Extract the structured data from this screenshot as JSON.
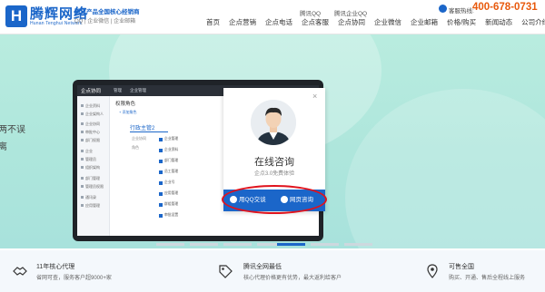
{
  "header": {
    "logo_mark": "H",
    "logo_name": "腾辉网络",
    "logo_en": "Hunan Tenghui Network",
    "slogan_line1": "腾讯产品全国核心经销商",
    "slogan_line2": "QQ | 企业微信 | 企业邮箱",
    "brand_tags": [
      "腾讯QQ",
      "腾讯企业QQ"
    ],
    "hotline_label": "客服热线:",
    "hotline_number": "400-678-0731",
    "nav": [
      "首页",
      "企点营销",
      "企点电话",
      "企点客服",
      "企点协同",
      "企业微信",
      "企业邮箱",
      "价格/购买",
      "新闻动态",
      "公司介绍"
    ]
  },
  "banner": {
    "left_text_1": "两不误",
    "left_text_2": "离"
  },
  "app": {
    "logo": "企点协同",
    "tabs": [
      "管理",
      "企业管理"
    ],
    "page_title": "权限角色",
    "add_label": "+ 添加角色",
    "role_name": "行政主管2",
    "perm_labels": [
      "企业协同",
      "角色"
    ],
    "side_items": [
      "企业资料",
      "企业架构人",
      "企业协同",
      "审批中心",
      "部门权限",
      "企业",
      "管理员",
      "组织架构",
      "部门管理",
      "管理员权限",
      "通讯录",
      "应用管理"
    ],
    "perm_items": [
      "企业管理",
      "企业资料",
      "部门管理",
      "员工管理",
      "企业号",
      "应用管理",
      "群组管理",
      "审批设置"
    ]
  },
  "popup": {
    "title": "在线咨询",
    "subtitle": "企点3.0免费体验",
    "qq_button": "用QQ交谈",
    "web_button": "网页咨询",
    "close": "×"
  },
  "features": [
    {
      "title": "11年核心代理",
      "desc": "省网可查，服务客户超9000+家"
    },
    {
      "title": "腾讯全网最低",
      "desc": "核心代理价格更有优势，最大返利给客户"
    },
    {
      "title": "可售全国",
      "desc": "购买、开通、售后全程线上服务"
    }
  ],
  "colors": {
    "brand": "#1b66c9",
    "hotline": "#e8590c",
    "highlight_ring": "#e0131d",
    "banner": "#b1e8dc"
  }
}
